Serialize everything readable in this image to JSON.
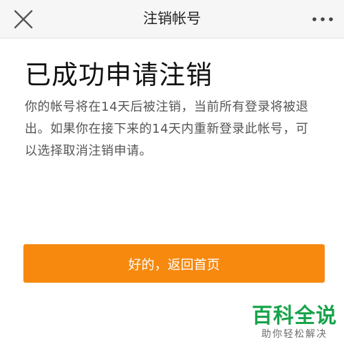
{
  "navbar": {
    "title": "注销帐号",
    "close_icon": "close-icon",
    "more_icon": "more-dots-icon"
  },
  "main": {
    "headline": "已成功申请注销",
    "description": "你的帐号将在14天后被注销，当前所有登录将被退出。如果你在接下来的14天内重新登录此帐号，可以选择取消注销申请。",
    "button_label": "好的，返回首页"
  },
  "watermark": {
    "title": "百科全说",
    "subtitle": "助你轻松解决"
  },
  "colors": {
    "accent": "#f7890f",
    "navbar_bg": "#f6f6f6",
    "watermark_green": "#17a34a"
  }
}
